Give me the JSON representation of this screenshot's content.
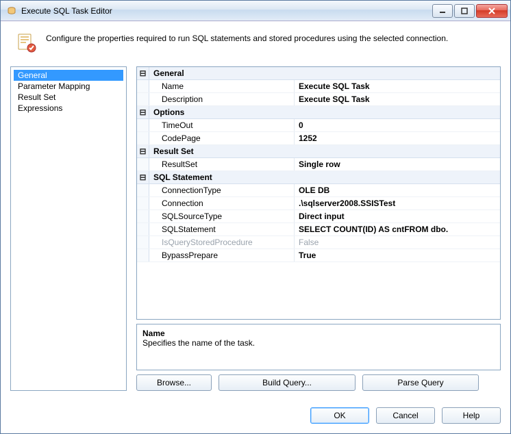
{
  "window": {
    "title": "Execute SQL Task Editor"
  },
  "header": {
    "description": "Configure the properties required to run SQL statements and stored procedures using the selected connection."
  },
  "nav": {
    "items": [
      {
        "label": "General",
        "selected": true
      },
      {
        "label": "Parameter Mapping",
        "selected": false
      },
      {
        "label": "Result Set",
        "selected": false
      },
      {
        "label": "Expressions",
        "selected": false
      }
    ]
  },
  "propgrid": {
    "categories": [
      {
        "label": "General",
        "props": [
          {
            "label": "Name",
            "value": "Execute SQL Task"
          },
          {
            "label": "Description",
            "value": "Execute SQL Task"
          }
        ]
      },
      {
        "label": "Options",
        "props": [
          {
            "label": "TimeOut",
            "value": "0"
          },
          {
            "label": "CodePage",
            "value": "1252"
          }
        ]
      },
      {
        "label": "Result Set",
        "props": [
          {
            "label": "ResultSet",
            "value": "Single row"
          }
        ]
      },
      {
        "label": "SQL Statement",
        "props": [
          {
            "label": "ConnectionType",
            "value": "OLE DB"
          },
          {
            "label": "Connection",
            "value": ".\\sqlserver2008.SSISTest"
          },
          {
            "label": "SQLSourceType",
            "value": "Direct input"
          },
          {
            "label": "SQLStatement",
            "value": "SELECT        COUNT(ID) AS cntFROM            dbo."
          },
          {
            "label": "IsQueryStoredProcedure",
            "value": "False",
            "disabled": true
          },
          {
            "label": "BypassPrepare",
            "value": "True"
          }
        ]
      }
    ]
  },
  "help": {
    "name": "Name",
    "text": "Specifies the name of the task."
  },
  "buttons": {
    "browse": "Browse...",
    "build": "Build Query...",
    "parse": "Parse Query",
    "ok": "OK",
    "cancel": "Cancel",
    "help": "Help"
  }
}
